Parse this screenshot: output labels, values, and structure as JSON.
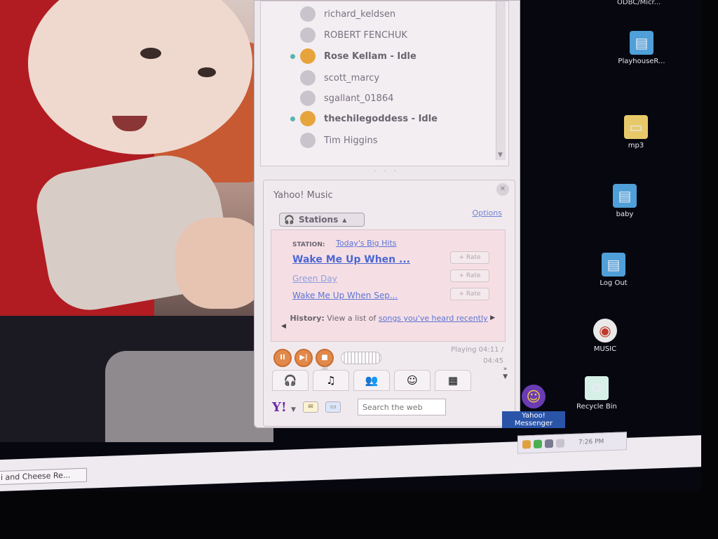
{
  "top_label": "ODBC/Micr...",
  "contacts": [
    {
      "name": "richard_keldsen",
      "status": ""
    },
    {
      "name": "ROBERT FENCHUK",
      "status": ""
    },
    {
      "name": "Rose Kellam",
      "status": "Idle"
    },
    {
      "name": "scott_marcy",
      "status": ""
    },
    {
      "name": "sgallant_01864",
      "status": ""
    },
    {
      "name": "thechilegoddess",
      "status": "Idle"
    },
    {
      "name": "Tim Higgins",
      "status": ""
    }
  ],
  "contact_labels": {
    "c0": "richard_keldsen",
    "c1": "ROBERT FENCHUK",
    "c2": "Rose Kellam - Idle",
    "c3": "scott_marcy",
    "c4": "sgallant_01864",
    "c5": "thechilegoddess - Idle",
    "c6": "Tim Higgins"
  },
  "music": {
    "title": "Yahoo! Music",
    "stations_label": "Stations",
    "options_label": "Options",
    "station_label": "STATION:",
    "station_name": "Today's Big Hits",
    "song_title": "Wake Me Up When ...",
    "artist": "Green Day",
    "album": "Wake Me Up When Sep...",
    "rate_label": "+ Rate",
    "history_prefix": "History:",
    "history_text": "View a list of",
    "history_link": "songs you've heard recently",
    "playing_label": "Playing",
    "playing_time": "04:11 /",
    "playing_total": "04:45"
  },
  "controls": {
    "pause": "II",
    "next": "▶|",
    "stop": "■"
  },
  "bottom_bar": {
    "logo": "Y!",
    "search_placeholder": "Search the web"
  },
  "desktop_icons": [
    {
      "label": "PlayhouseR...",
      "icon": "file-icon"
    },
    {
      "label": "mp3",
      "icon": "folder-icon"
    },
    {
      "label": "baby",
      "icon": "file-icon"
    },
    {
      "label": "Log Out",
      "icon": "file-icon"
    },
    {
      "label": "MUSIC",
      "icon": "music-icon"
    },
    {
      "label": "Recycle Bin",
      "icon": "recycle-bin-icon"
    },
    {
      "label": "Yahoo! Messenger",
      "icon": "messenger-icon"
    }
  ],
  "desk_labels": {
    "d0": "PlayhouseR...",
    "d1": "mp3",
    "d2": "baby",
    "d3": "Log Out",
    "d4": "MUSIC",
    "d5": "Recycle Bin",
    "d6": "Yahoo! Messenger"
  },
  "taskbar": {
    "task_button": "i and Cheese Re...",
    "clock": "7:26 PM"
  },
  "colors": {
    "accent_orange": "#e1894a",
    "link_blue": "#5b74d7",
    "yahoo_purple": "#6d2aa8"
  }
}
